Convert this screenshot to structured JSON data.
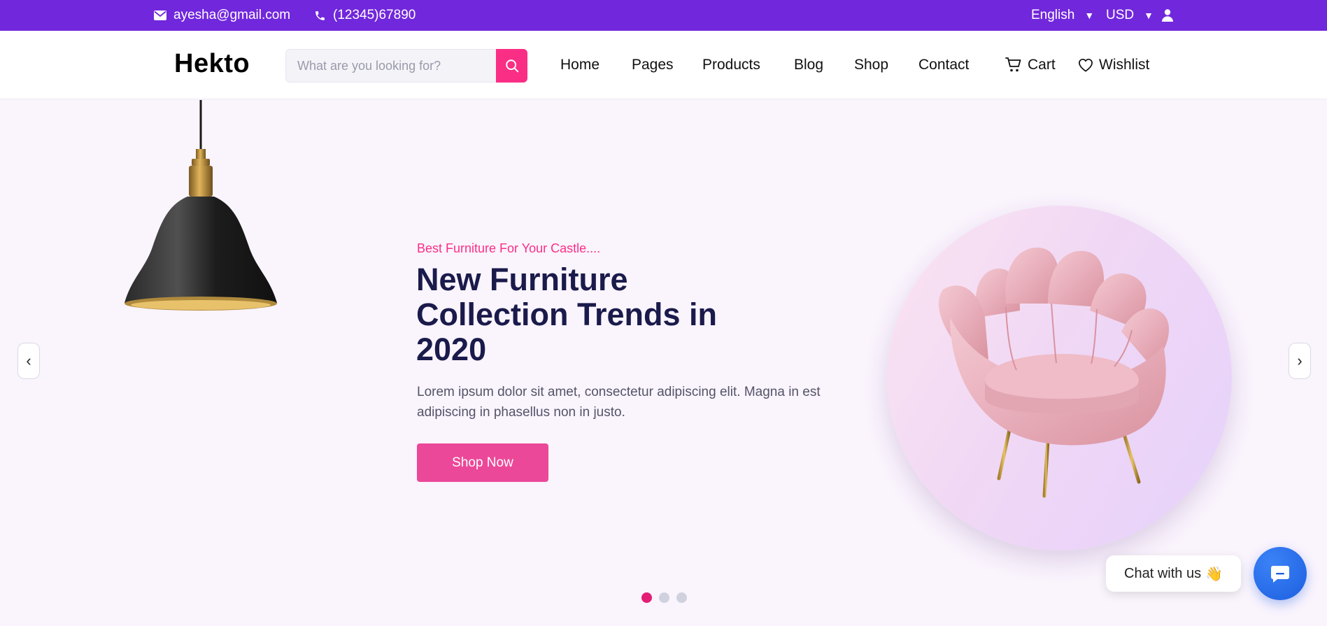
{
  "topbar": {
    "email": "ayesha@gmail.com",
    "phone": "(12345)67890",
    "language": "English",
    "currency": "USD",
    "icons": [
      "mail-icon",
      "phone-icon",
      "user-icon",
      "caret-down-icon"
    ]
  },
  "header": {
    "logo": "Hekto",
    "search_placeholder": "What are you looking for?",
    "nav": [
      "Home",
      "Pages",
      "Products",
      "Blog",
      "Shop",
      "Contact"
    ],
    "cart_label": "Cart",
    "wishlist_label": "Wishlist"
  },
  "hero": {
    "subtitle": "Best Furniture For Your Castle....",
    "title": "New Furniture Collection Trends in 2020",
    "description": "Lorem ipsum dolor sit amet, consectetur adipiscing elit. Magna in est adipiscing in phasellus non in justo.",
    "cta": "Shop Now",
    "prev": "‹",
    "next": "›",
    "slides_count": 3,
    "active_slide": 1
  },
  "chat": {
    "label": "Chat with us",
    "emoji": "👋"
  },
  "colors": {
    "topbar": "#7127dc",
    "accent": "#fb2e86",
    "button": "#ec4899",
    "title": "#1a1b4b",
    "hero_bg": "#faf4fd",
    "chat": "#1d5fe0"
  }
}
